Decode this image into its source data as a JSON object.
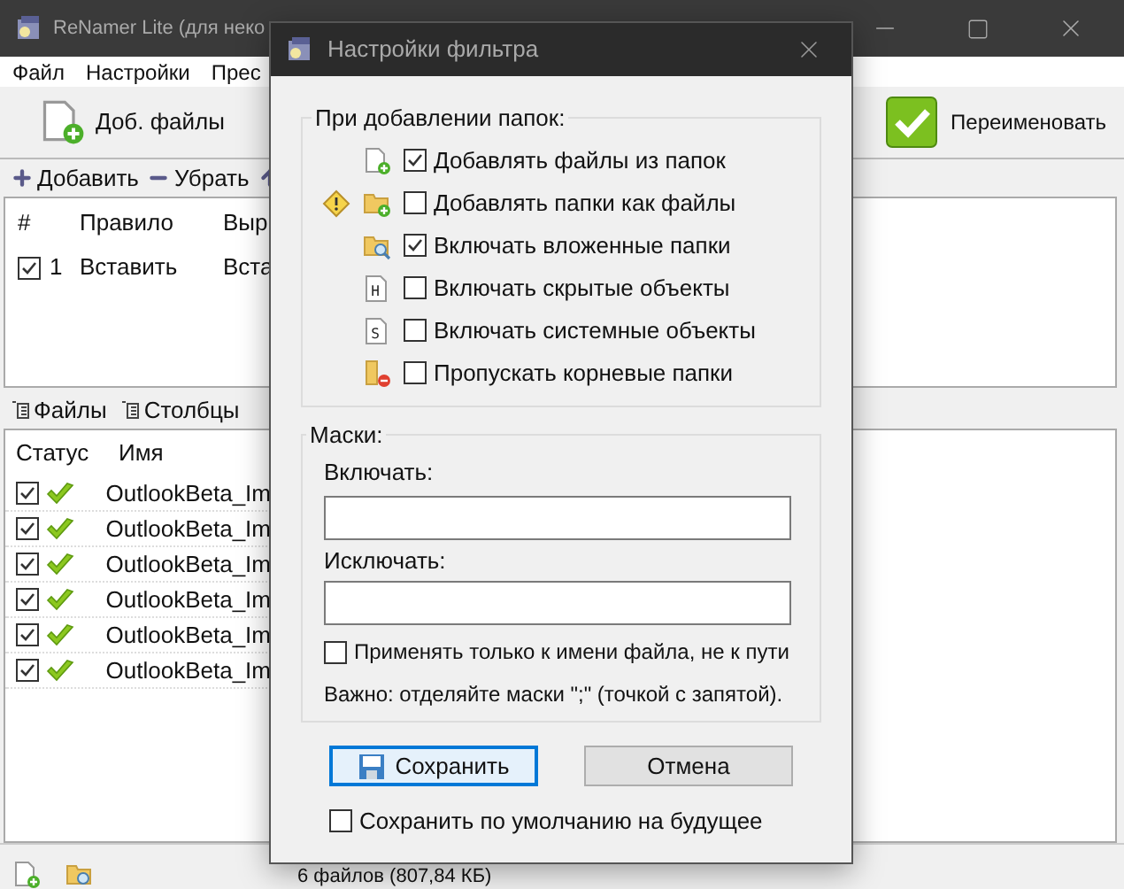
{
  "main_window": {
    "title": "ReNamer Lite (для неко",
    "menu": [
      "Файл",
      "Настройки",
      "Прес"
    ],
    "toolbar": {
      "add_files": "Доб. файлы",
      "rename": "Переименовать"
    },
    "rules_toolbar": [
      {
        "kind": "add",
        "label": "Добавить"
      },
      {
        "kind": "remove",
        "label": "Убрать"
      }
    ],
    "rules_table": {
      "columns": [
        "#",
        "Правило",
        "Выр"
      ],
      "rows": [
        {
          "checked": true,
          "number": "1",
          "rule": "Вставить",
          "column_3": "Вста"
        }
      ]
    },
    "files_toolbar": [
      "Файлы",
      "Столбцы"
    ],
    "files_table": {
      "columns": [
        "Статус",
        "Имя"
      ],
      "rows": [
        {
          "checked": true,
          "name": "OutlookBeta_Im"
        },
        {
          "checked": true,
          "name": "OutlookBeta_Im"
        },
        {
          "checked": true,
          "name": "OutlookBeta_Im"
        },
        {
          "checked": true,
          "name": "OutlookBeta_Im"
        },
        {
          "checked": true,
          "name": "OutlookBeta_Im"
        },
        {
          "checked": true,
          "name": "OutlookBeta_Im"
        }
      ]
    },
    "status_bar": {
      "summary": "6 файлов (807,84 КБ)"
    }
  },
  "dialog": {
    "title": "Настройки фильтра",
    "folder_group": {
      "title": "При добавлении папок:",
      "options": [
        {
          "kind": "file-add",
          "warning": false,
          "checked": true,
          "label": "Добавлять файлы из папок"
        },
        {
          "kind": "folder-add",
          "warning": true,
          "checked": false,
          "label": "Добавлять папки как файлы"
        },
        {
          "kind": "folder-search",
          "warning": false,
          "checked": true,
          "label": "Включать вложенные папки"
        },
        {
          "kind": "letter-file",
          "badge": "H",
          "warning": false,
          "checked": false,
          "label": "Включать скрытые объекты"
        },
        {
          "kind": "letter-file",
          "badge": "S",
          "warning": false,
          "checked": false,
          "label": "Включать системные объекты"
        },
        {
          "kind": "folder-remove",
          "warning": false,
          "checked": false,
          "label": "Пропускать корневые папки"
        }
      ]
    },
    "masks_group": {
      "title": "Маски:",
      "include_label": "Включать:",
      "exclude_label": "Исключать:",
      "name_only": {
        "checked": false,
        "label": "Применять только к имени файла, не к пути"
      },
      "note": "Важно: отделяйте маски \";\" (точкой с запятой)."
    },
    "buttons": [
      {
        "kind": "save",
        "focused": true,
        "label": "Сохранить"
      },
      {
        "kind": "cancel",
        "focused": false,
        "label": "Отмена"
      }
    ],
    "save_default": {
      "checked": false,
      "label": "Сохранить по умолчанию на будущее"
    }
  }
}
